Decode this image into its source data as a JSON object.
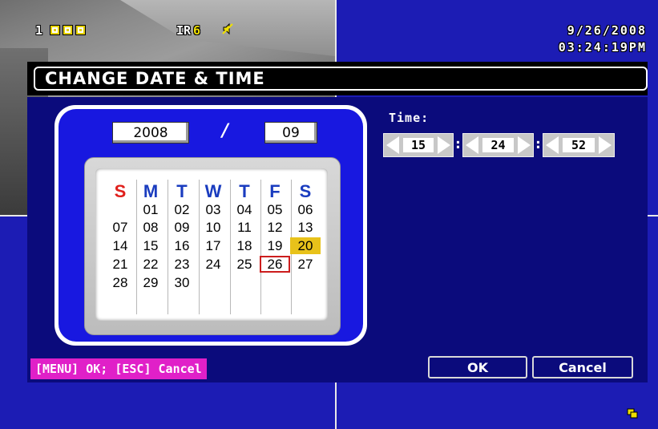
{
  "osd": {
    "camera_number": "1",
    "ir_label": "IR",
    "ir_value": "6",
    "date": "9/26/2008",
    "time": "03:24:19PM"
  },
  "dialog": {
    "title": "CHANGE DATE & TIME",
    "year": "2008",
    "separator": "/",
    "month": "09",
    "weekdays": [
      "S",
      "M",
      "T",
      "W",
      "T",
      "F",
      "S"
    ],
    "weeks": [
      [
        "",
        "01",
        "02",
        "03",
        "04",
        "05",
        "06"
      ],
      [
        "07",
        "08",
        "09",
        "10",
        "11",
        "12",
        "13"
      ],
      [
        "14",
        "15",
        "16",
        "17",
        "18",
        "19",
        "20"
      ],
      [
        "21",
        "22",
        "23",
        "24",
        "25",
        "26",
        "27"
      ],
      [
        "28",
        "29",
        "30",
        "",
        "",
        "",
        ""
      ]
    ],
    "highlighted_day": "20",
    "today": "26",
    "time_label": "Time:",
    "hour": "15",
    "minute": "24",
    "second": "52",
    "hint": "[MENU] OK; [ESC] Cancel",
    "ok_label": "OK",
    "cancel_label": "Cancel"
  },
  "colors": {
    "panel": "#0b0b7c",
    "background": "#1c1cb4",
    "calendar_frame": "#1818e0",
    "highlight": "#e8c21a",
    "today_border": "#cc1d1d",
    "hint_bg": "#e020c8"
  }
}
